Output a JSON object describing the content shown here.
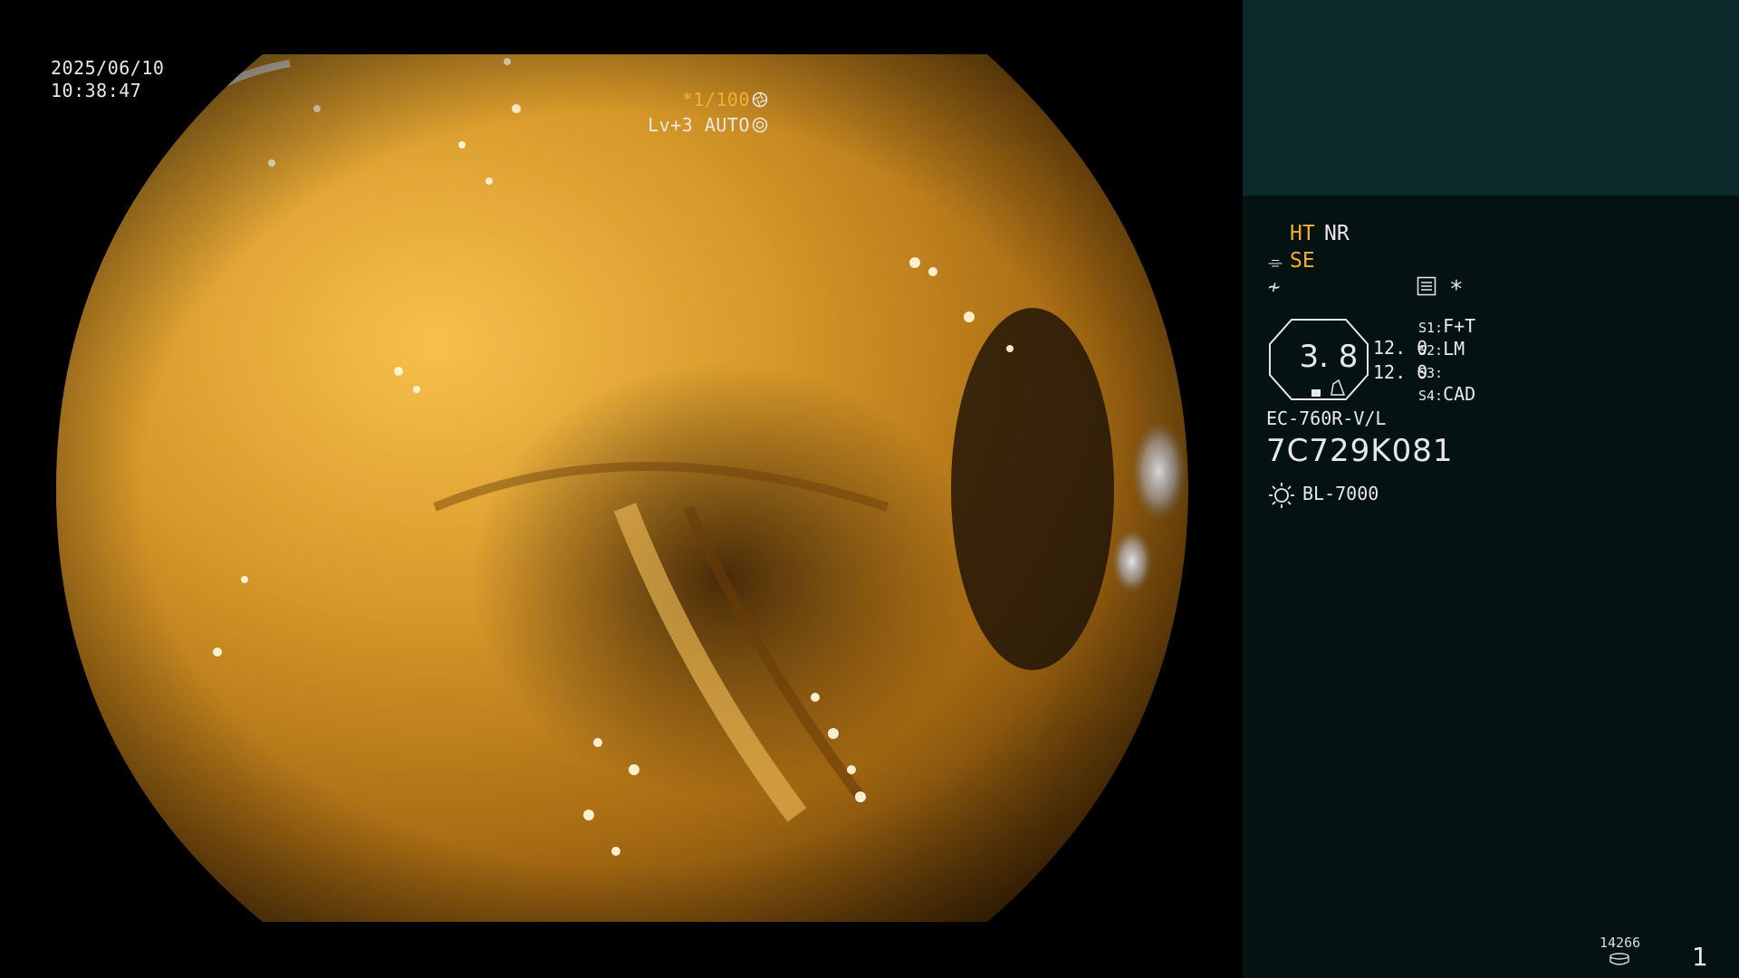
{
  "overlay": {
    "date": "2025/06/10",
    "time": "10:38:47",
    "shutter": "*1/100",
    "level": "Lv+3 AUTO"
  },
  "panel": {
    "ht": "HT",
    "nr": "NR",
    "se": "SE",
    "zoom_value": "3. 8",
    "zoom_a": "12. 0",
    "zoom_b": "12. 0",
    "switches": [
      {
        "key": "S1:",
        "value": "F+T"
      },
      {
        "key": "S2:",
        "value": "LM"
      },
      {
        "key": "S3:",
        "value": ""
      },
      {
        "key": "S4:",
        "value": "CAD"
      }
    ],
    "scope_model": "EC-760R-V/L",
    "scope_serial": "7C729K081",
    "light_source": "BL-7000",
    "counter": "14266",
    "page": "1"
  },
  "colors": {
    "panel_bg": "#051212",
    "patient_box_bg": "#0b2a2c",
    "accent_orange": "#f0b030",
    "text": "#e8e8e8"
  },
  "icons": [
    "structure-enhance-icon",
    "freeze-icon",
    "menu-icon",
    "star-icon",
    "iris-icon",
    "light-source-icon",
    "storage-icon"
  ]
}
